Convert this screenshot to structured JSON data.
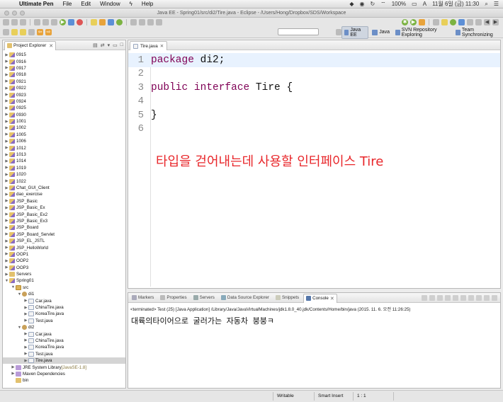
{
  "menubar": {
    "app": "Ultimate Pen",
    "items": [
      "File",
      "Edit",
      "Window",
      "Help"
    ],
    "battery": "100%",
    "clock": "11월 6일 (금)  11:30"
  },
  "window": {
    "title": "Java EE - Spring01/src/di2/Tire.java - Eclipse - /Users/Hong/Dropbox/SDS/Workspace"
  },
  "perspectives": [
    "Java EE",
    "Java",
    "SVN Repository Exploring",
    "Team Synchronizing"
  ],
  "explorer": {
    "tab_label": "Project Explorer",
    "close": "✕",
    "rows": [
      {
        "label": "0915",
        "indent": 0,
        "tw": "▶",
        "icon": "proj"
      },
      {
        "label": "0916",
        "indent": 0,
        "tw": "▶",
        "icon": "proj"
      },
      {
        "label": "0917",
        "indent": 0,
        "tw": "▶",
        "icon": "proj"
      },
      {
        "label": "0918",
        "indent": 0,
        "tw": "▶",
        "icon": "proj"
      },
      {
        "label": "0921",
        "indent": 0,
        "tw": "▶",
        "icon": "proj"
      },
      {
        "label": "0922",
        "indent": 0,
        "tw": "▶",
        "icon": "proj"
      },
      {
        "label": "0923",
        "indent": 0,
        "tw": "▶",
        "icon": "proj"
      },
      {
        "label": "0924",
        "indent": 0,
        "tw": "▶",
        "icon": "proj"
      },
      {
        "label": "0925",
        "indent": 0,
        "tw": "▶",
        "icon": "proj"
      },
      {
        "label": "0930",
        "indent": 0,
        "tw": "▶",
        "icon": "proj"
      },
      {
        "label": "1001",
        "indent": 0,
        "tw": "▶",
        "icon": "proj"
      },
      {
        "label": "1002",
        "indent": 0,
        "tw": "▶",
        "icon": "proj"
      },
      {
        "label": "1005",
        "indent": 0,
        "tw": "▶",
        "icon": "proj"
      },
      {
        "label": "1006",
        "indent": 0,
        "tw": "▶",
        "icon": "proj"
      },
      {
        "label": "1012",
        "indent": 0,
        "tw": "▶",
        "icon": "proj"
      },
      {
        "label": "1013",
        "indent": 0,
        "tw": "▶",
        "icon": "proj"
      },
      {
        "label": "1014",
        "indent": 0,
        "tw": "▶",
        "icon": "proj"
      },
      {
        "label": "1019",
        "indent": 0,
        "tw": "▶",
        "icon": "proj"
      },
      {
        "label": "1020",
        "indent": 0,
        "tw": "▶",
        "icon": "proj"
      },
      {
        "label": "1022",
        "indent": 0,
        "tw": "▶",
        "icon": "proj"
      },
      {
        "label": "Chat_GUI_Client",
        "indent": 0,
        "tw": "▶",
        "icon": "proj"
      },
      {
        "label": "dao_exercise",
        "indent": 0,
        "tw": "▶",
        "icon": "proj"
      },
      {
        "label": "JSP_Basic",
        "indent": 0,
        "tw": "▶",
        "icon": "proj"
      },
      {
        "label": "JSP_Basic_Ex",
        "indent": 0,
        "tw": "▶",
        "icon": "proj"
      },
      {
        "label": "JSP_Basic_Ex2",
        "indent": 0,
        "tw": "▶",
        "icon": "proj"
      },
      {
        "label": "JSP_Basic_Ex3",
        "indent": 0,
        "tw": "▶",
        "icon": "proj"
      },
      {
        "label": "JSP_Board",
        "indent": 0,
        "tw": "▶",
        "icon": "proj"
      },
      {
        "label": "JSP_Board_Servlet",
        "indent": 0,
        "tw": "▶",
        "icon": "proj"
      },
      {
        "label": "JSP_EL_JSTL",
        "indent": 0,
        "tw": "▶",
        "icon": "proj"
      },
      {
        "label": "JSP_HelloWorld",
        "indent": 0,
        "tw": "▶",
        "icon": "proj"
      },
      {
        "label": "OOP1",
        "indent": 0,
        "tw": "▶",
        "icon": "proj"
      },
      {
        "label": "OOP2",
        "indent": 0,
        "tw": "▶",
        "icon": "proj"
      },
      {
        "label": "OOP3",
        "indent": 0,
        "tw": "▶",
        "icon": "proj"
      },
      {
        "label": "Servers",
        "indent": 0,
        "tw": "▶",
        "icon": "folder"
      },
      {
        "label": "Spring01",
        "indent": 0,
        "tw": "▼",
        "icon": "proj"
      },
      {
        "label": "src",
        "indent": 1,
        "tw": "▼",
        "icon": "src"
      },
      {
        "label": "di1",
        "indent": 2,
        "tw": "▼",
        "icon": "pkg"
      },
      {
        "label": "Car.java",
        "indent": 3,
        "tw": "▶",
        "icon": "java"
      },
      {
        "label": "ChinaTire.java",
        "indent": 3,
        "tw": "▶",
        "icon": "java"
      },
      {
        "label": "KoreaTire.java",
        "indent": 3,
        "tw": "▶",
        "icon": "java"
      },
      {
        "label": "Test.java",
        "indent": 3,
        "tw": "▶",
        "icon": "java"
      },
      {
        "label": "di2",
        "indent": 2,
        "tw": "▼",
        "icon": "pkg"
      },
      {
        "label": "Car.java",
        "indent": 3,
        "tw": "▶",
        "icon": "java"
      },
      {
        "label": "ChinaTire.java",
        "indent": 3,
        "tw": "▶",
        "icon": "java"
      },
      {
        "label": "KoreaTire.java",
        "indent": 3,
        "tw": "▶",
        "icon": "java"
      },
      {
        "label": "Test.java",
        "indent": 3,
        "tw": "▶",
        "icon": "java"
      },
      {
        "label": "Tire.java",
        "indent": 3,
        "tw": "▶",
        "icon": "java",
        "selected": true
      },
      {
        "label": "JRE System Library",
        "suffix": " [JavaSE-1.8]",
        "indent": 1,
        "tw": "▶",
        "icon": "lib"
      },
      {
        "label": "Maven Dependencies",
        "indent": 1,
        "tw": "▶",
        "icon": "lib"
      },
      {
        "label": "bin",
        "indent": 1,
        "tw": "",
        "icon": "folder"
      }
    ]
  },
  "editor": {
    "tab_label": "Tire.java",
    "close": "✕",
    "lines": [
      {
        "num": "1",
        "kw": "package",
        "rest": " di2;",
        "current": true
      },
      {
        "num": "2",
        "kw": "",
        "rest": ""
      },
      {
        "num": "3",
        "kw": "public interface",
        "rest": " Tire {"
      },
      {
        "num": "4",
        "kw": "",
        "rest": ""
      },
      {
        "num": "5",
        "kw": "",
        "rest": "}"
      },
      {
        "num": "6",
        "kw": "",
        "rest": ""
      }
    ],
    "annotation": "타입을 걷어내는데 사용할 인터페이스 Tire",
    "annotation_color": "#e8262a"
  },
  "console": {
    "tabs": [
      "Markers",
      "Properties",
      "Servers",
      "Data Source Explorer",
      "Snippets",
      "Console"
    ],
    "close": "✕",
    "terminated": "<terminated> Test (25) [Java Application] /Library/Java/JavaVirtualMachines/jdk1.8.0_40.jdk/Contents/Home/bin/java (2015. 11. 6. 오전 11:26:25)",
    "output": "대륙의타이어으로 굴러가는 자동차 붕붕ㅋ"
  },
  "statusbar": {
    "writable": "Writable",
    "insert_mode": "Smart Insert",
    "position": "1 : 1"
  }
}
